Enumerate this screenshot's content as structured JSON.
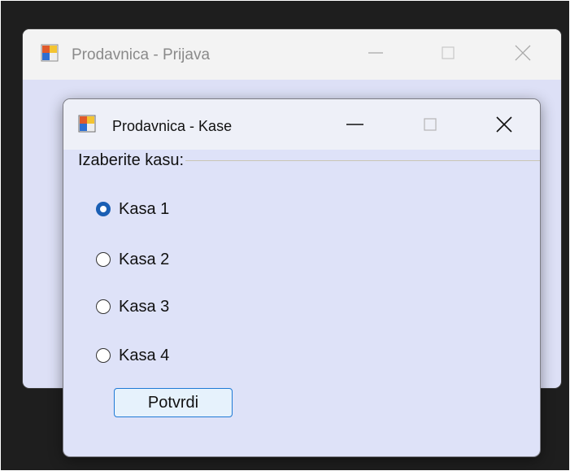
{
  "background_window": {
    "title": "Prodavnica - Prijava",
    "app_icon": "app-window-icon",
    "controls": [
      "minimize-icon",
      "maximize-icon",
      "close-icon"
    ]
  },
  "dialog": {
    "title": "Prodavnica - Kase",
    "app_icon": "app-window-icon",
    "controls": [
      "minimize-icon",
      "maximize-icon",
      "close-icon"
    ],
    "group_label": "Izaberite kasu:",
    "options": [
      {
        "label": "Kasa 1",
        "checked": true
      },
      {
        "label": "Kasa 2",
        "checked": false
      },
      {
        "label": "Kasa 3",
        "checked": false
      },
      {
        "label": "Kasa 4",
        "checked": false
      }
    ],
    "confirm_label": "Potvrdi"
  },
  "colors": {
    "window_bg": "#dee2f8",
    "accent": "#1a5fb4",
    "button_border": "#1f7ad6"
  }
}
